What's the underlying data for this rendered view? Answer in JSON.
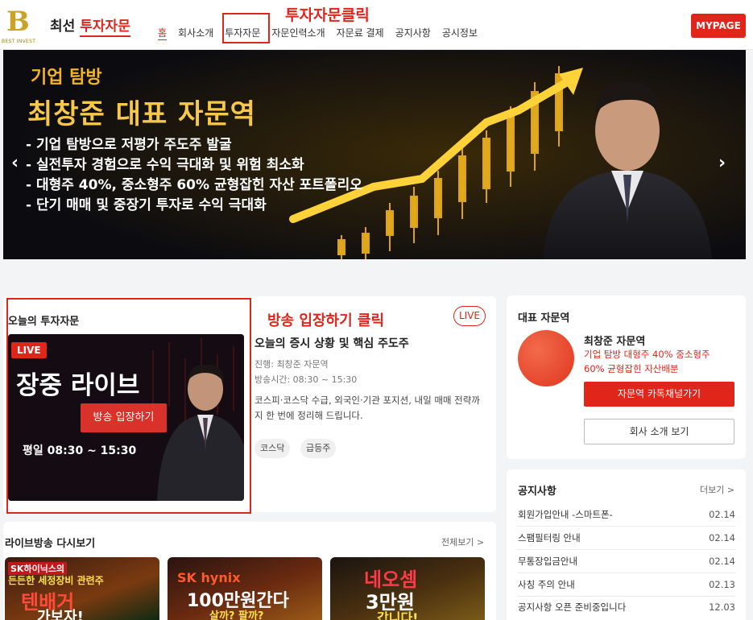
{
  "header": {
    "logo_letter": "B",
    "logo_caption": "BEST INVEST",
    "brand_1": "최선",
    "brand_2": "투자자문",
    "nav": [
      "홈",
      "회사소개",
      "투자자문",
      "자문인력소개",
      "자문료 결제",
      "공지사항",
      "공시정보"
    ],
    "mypage": "MYPAGE"
  },
  "annotations": {
    "nav_click": "투자자문클릭",
    "enter_click": "방송 입장하기 클릭"
  },
  "hero": {
    "tag": "기업 탐방",
    "title": "최창준 대표 자문역",
    "bullets": [
      "-  기업 탐방으로 저평가 주도주 발굴",
      "-  실전투자 경험으로 수익 극대화 및 위험 최소화",
      "-  대형주 40%, 중소형주 60% 균형잡힌 자산 포트폴리오",
      "-  단기 매매 및 중장기 투자로 수익 극대화"
    ],
    "prev": "‹",
    "next": "›"
  },
  "today": {
    "heading": "오늘의 투자자문",
    "live_badge": "LIVE",
    "thumb_title": "장중 라이브",
    "thumb_time": "평일 08:30 ~ 15:30",
    "enter_button": "방송 입장하기",
    "live_pill": "LIVE",
    "title": "오늘의 증시 상황 및 핵심 주도주",
    "host": "진행: 최창준 자문역",
    "time": "방송시간: 08:30 ~ 15:30",
    "desc": "코스피·코스닥 수급, 외국인·기관 포지션, 내일 매매 전략까지 한 번에 정리해 드립니다.",
    "tags": [
      "코스닥",
      "급등주"
    ]
  },
  "replay": {
    "heading": "라이브방송 다시보기",
    "more": "전체보기 >",
    "items": [
      {
        "line1": "SK하이닉스의",
        "line2": "든든한 세정장비 관련주",
        "line3": "텐배거",
        "line4": "가보자!"
      },
      {
        "line1": "SK hynix",
        "line2": "100만원간다",
        "line3": "살까? 팔까?"
      },
      {
        "line1": "네오셈",
        "line2": "3만원",
        "line3": "갑니다!"
      }
    ]
  },
  "advisor": {
    "heading": "대표 자문역",
    "name": "최창준 자문역",
    "desc1": "기업 탐방 대형주 40% 중소형주",
    "desc2": "60% 균형잡힌 자산배분",
    "kakao_button": "자문역 카톡채널가기",
    "company_button": "회사 소개 보기"
  },
  "notice": {
    "heading": "공지사항",
    "more": "더보기 >",
    "items": [
      {
        "title": "회원가입안내 -스마트폰-",
        "date": "02.14"
      },
      {
        "title": "스팸필터링 안내",
        "date": "02.14"
      },
      {
        "title": "무통장입금안내",
        "date": "02.14"
      },
      {
        "title": "사칭 주의 안내",
        "date": "02.13"
      },
      {
        "title": "공지사항 오픈 준비중입니다",
        "date": "12.03"
      }
    ]
  },
  "colors": {
    "accent": "#e0251b",
    "gold": "#f5c84a"
  }
}
